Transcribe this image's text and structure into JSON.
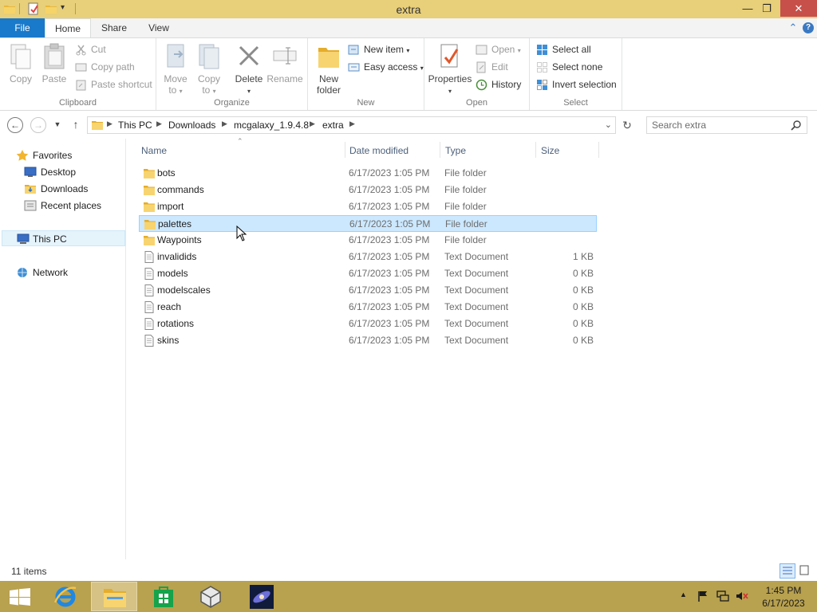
{
  "window": {
    "title": "extra",
    "minimize": "—",
    "maximize": "❐",
    "close": "✕"
  },
  "ribbon": {
    "tabs": {
      "file": "File",
      "home": "Home",
      "share": "Share",
      "view": "View"
    },
    "clipboard": {
      "label": "Clipboard",
      "copy": "Copy",
      "paste": "Paste",
      "cut": "Cut",
      "copy_path": "Copy path",
      "paste_shortcut": "Paste shortcut"
    },
    "organize": {
      "label": "Organize",
      "move_to_1": "Move",
      "move_to_2": "to",
      "copy_to_1": "Copy",
      "copy_to_2": "to",
      "delete": "Delete",
      "rename": "Rename"
    },
    "new": {
      "label": "New",
      "new_folder_1": "New",
      "new_folder_2": "folder",
      "new_item": "New item",
      "easy_access": "Easy access"
    },
    "open": {
      "label": "Open",
      "properties": "Properties",
      "open": "Open",
      "edit": "Edit",
      "history": "History"
    },
    "select": {
      "label": "Select",
      "select_all": "Select all",
      "select_none": "Select none",
      "invert_selection": "Invert selection"
    }
  },
  "address": {
    "crumbs": [
      "This PC",
      "Downloads",
      "mcgalaxy_1.9.4.8",
      "extra"
    ]
  },
  "search": {
    "placeholder": "Search extra"
  },
  "nav": {
    "favorites": "Favorites",
    "desktop": "Desktop",
    "downloads": "Downloads",
    "recent": "Recent places",
    "this_pc": "This PC",
    "network": "Network"
  },
  "columns": {
    "name": "Name",
    "date": "Date modified",
    "type": "Type",
    "size": "Size"
  },
  "files": [
    {
      "name": "bots",
      "date": "6/17/2023 1:05 PM",
      "type": "File folder",
      "size": "",
      "kind": "folder"
    },
    {
      "name": "commands",
      "date": "6/17/2023 1:05 PM",
      "type": "File folder",
      "size": "",
      "kind": "folder"
    },
    {
      "name": "import",
      "date": "6/17/2023 1:05 PM",
      "type": "File folder",
      "size": "",
      "kind": "folder"
    },
    {
      "name": "palettes",
      "date": "6/17/2023 1:05 PM",
      "type": "File folder",
      "size": "",
      "kind": "folder"
    },
    {
      "name": "Waypoints",
      "date": "6/17/2023 1:05 PM",
      "type": "File folder",
      "size": "",
      "kind": "folder"
    },
    {
      "name": "invalidids",
      "date": "6/17/2023 1:05 PM",
      "type": "Text Document",
      "size": "1 KB",
      "kind": "text"
    },
    {
      "name": "models",
      "date": "6/17/2023 1:05 PM",
      "type": "Text Document",
      "size": "0 KB",
      "kind": "text"
    },
    {
      "name": "modelscales",
      "date": "6/17/2023 1:05 PM",
      "type": "Text Document",
      "size": "0 KB",
      "kind": "text"
    },
    {
      "name": "reach",
      "date": "6/17/2023 1:05 PM",
      "type": "Text Document",
      "size": "0 KB",
      "kind": "text"
    },
    {
      "name": "rotations",
      "date": "6/17/2023 1:05 PM",
      "type": "Text Document",
      "size": "0 KB",
      "kind": "text"
    },
    {
      "name": "skins",
      "date": "6/17/2023 1:05 PM",
      "type": "Text Document",
      "size": "0 KB",
      "kind": "text"
    }
  ],
  "selected_index": 3,
  "status": {
    "items": "11 items"
  },
  "taskbar": {
    "time": "1:45 PM",
    "date": "6/17/2023"
  },
  "colors": {
    "titlebar": "#e8cf79",
    "taskbar": "#b8a14f",
    "accent": "#1979ca",
    "selection": "#cce8ff"
  }
}
